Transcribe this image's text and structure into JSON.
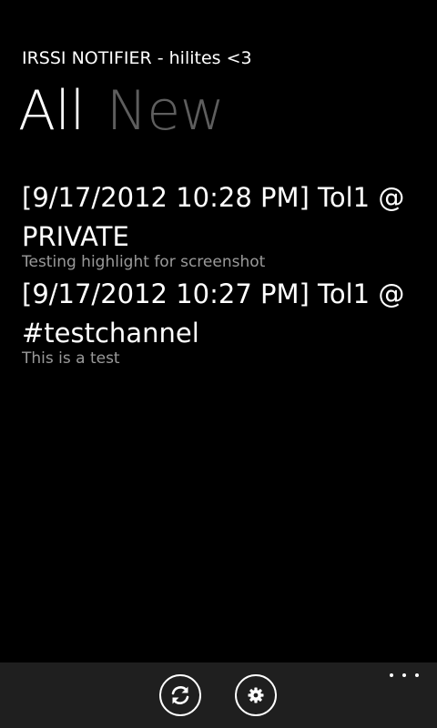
{
  "app": {
    "title": "IRSSI NOTIFIER - hilites <3"
  },
  "pivot": {
    "items": [
      {
        "label": "All",
        "active": true
      },
      {
        "label": "New",
        "active": false
      }
    ]
  },
  "messages": [
    {
      "header": "[9/17/2012 10:28 PM] Tol1 @ PRIVATE",
      "body": "Testing highlight for screenshot"
    },
    {
      "header": "[9/17/2012 10:27 PM] Tol1 @ #testchannel",
      "body": "This is a test"
    }
  ],
  "app_bar": {
    "buttons": [
      {
        "icon": "refresh-icon"
      },
      {
        "icon": "gear-icon"
      }
    ],
    "more_icon": "ellipsis-icon"
  },
  "colors": {
    "background": "#000000",
    "foreground": "#ffffff",
    "inactive_pivot": "#5e5e5e",
    "secondary_text": "#9a9a9a",
    "app_bar": "#1f1f1f"
  }
}
